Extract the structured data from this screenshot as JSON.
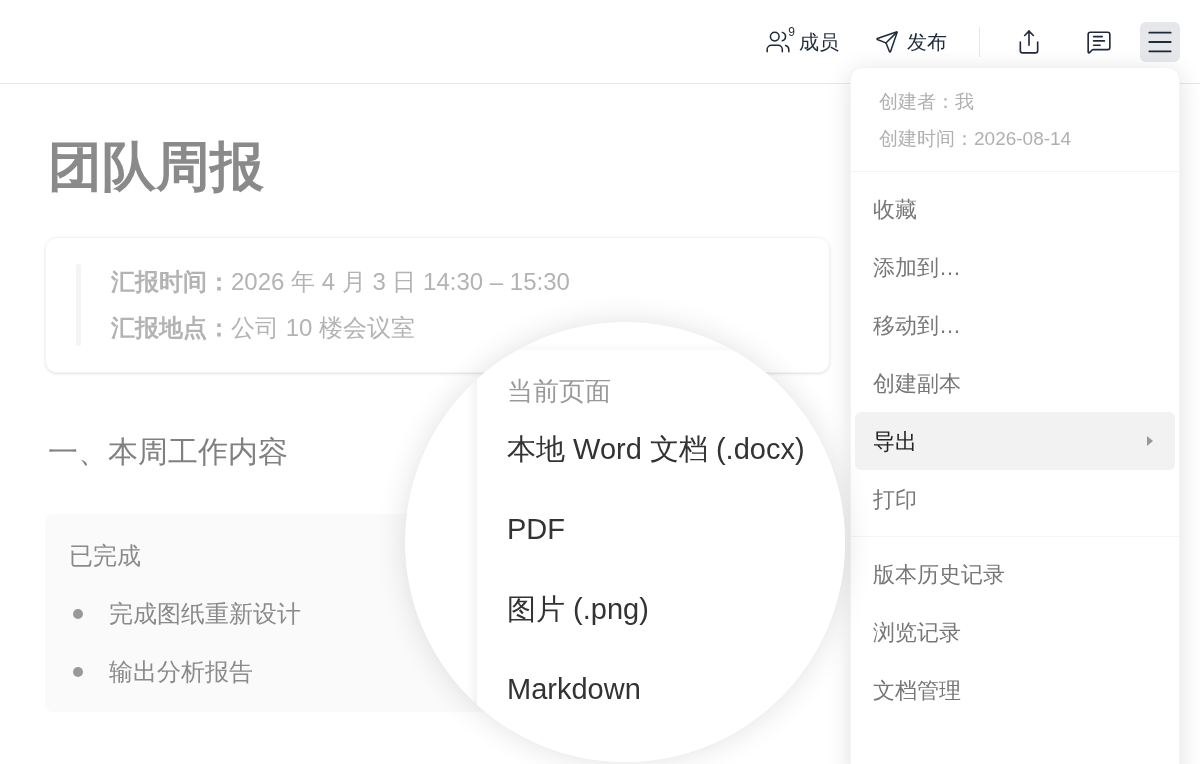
{
  "toolbar": {
    "members": {
      "label": "成员",
      "count": "9"
    },
    "publish": {
      "label": "发布"
    },
    "menu_button": {
      "selected": true
    }
  },
  "document": {
    "title": "团队周报",
    "info": [
      {
        "label": "汇报时间：",
        "value": "2026 年 4 月 3 日 14:30 – 15:30"
      },
      {
        "label": "汇报地点：",
        "value": "公司 10 楼会议室"
      }
    ],
    "section_heading": "一、本周工作内容",
    "card": {
      "title": "已完成",
      "items": [
        "完成图纸重新设计",
        "输出分析报告"
      ]
    }
  },
  "menu": {
    "meta": [
      "创建者：我",
      "创建时间：2026-08-14"
    ],
    "groups": [
      [
        {
          "label": "收藏",
          "selected": false,
          "has_submenu": false
        },
        {
          "label": "添加到…",
          "selected": false,
          "has_submenu": false
        },
        {
          "label": "移动到…",
          "selected": false,
          "has_submenu": false
        },
        {
          "label": "创建副本",
          "selected": false,
          "has_submenu": false
        },
        {
          "label": "导出",
          "selected": true,
          "has_submenu": true
        },
        {
          "label": "打印",
          "selected": false,
          "has_submenu": false
        }
      ],
      [
        {
          "label": "版本历史记录",
          "selected": false,
          "has_submenu": false
        },
        {
          "label": "浏览记录",
          "selected": false,
          "has_submenu": false
        },
        {
          "label": "文档管理",
          "selected": false,
          "has_submenu": false
        }
      ]
    ]
  },
  "magnifier": {
    "heading": "当前页面",
    "items": [
      "本地 Word 文档 (.docx)",
      "PDF",
      "图片 (.png)",
      "Markdown"
    ]
  }
}
